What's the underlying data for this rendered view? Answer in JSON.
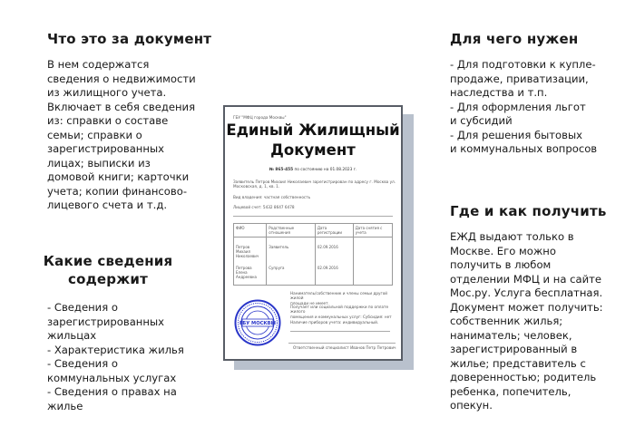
{
  "sections": {
    "what": {
      "heading": "Что это за документ",
      "text": "В нем содержатся\nсведения о недвижимости\nиз жилищного учета.\nВключает в себя сведения\nиз: справки о составе\nсемьи; справки о\nзарегистрированных\nлицах; выписки из\nдомовой книги; карточки\nучета; копии финансово-\nлицевого счета и т.д."
    },
    "contents": {
      "heading": "Какие сведения\nсодержит",
      "text": "- Сведения о\nзарегистрированных\nжильцах\n- Характеристика жилья\n- Сведения о\nкоммунальных услугах\n- Сведения о правах на\nжилье"
    },
    "why": {
      "heading": "Для чего нужен",
      "text": "- Для подготовки к купле-\nпродаже, приватизации,\nнаследства и т.п.\n- Для оформления льгот\nи субсидий\n- Для решения бытовых\nи коммунальных вопросов"
    },
    "where": {
      "heading": "Где и как получить",
      "text": "ЕЖД выдают только в\nМоскве. Его можно\nполучить в любом\nотделении МФЦ и на сайте\nМос.ру. Услуга бесплатная.\nДокумент может получить:\nсобственник жилья;\nнаниматель; человек,\nзарегистрированный в\nжилье; представитель с\nдоверенностью; родитель\nребенка, попечитель,\nопекун."
    }
  },
  "document": {
    "issuer": "ГБУ \"МФЦ города Москвы\"",
    "title": "Единый Жилищный\nДокумент",
    "number_label": "№ 865-455",
    "number_date": "по состоянию на 01.08.2023 г.",
    "applicant": "Заявитель Петров Михаил Николаевич зарегистрирован по адресу г. Москва ул.\nМосковская, д. 1, кв. 1.",
    "ownership": "Вид владения: частная собственность",
    "account": "Лицевой счет: 5432 8647 6478",
    "table": {
      "headers": [
        "ФИО",
        "Родственные отношения",
        "Дата регистрации",
        "Дата снятия с учета"
      ],
      "rows": [
        [
          "Петров Михаил\nНиколаевич",
          "Заявитель",
          "02.09.2016",
          ""
        ],
        [
          "Петрова Елена\nАндреевна",
          "Супруга",
          "02.09.2016",
          ""
        ]
      ]
    },
    "notes": [
      "Наниматель/собственник и члены семьи другой жилой\nплощади не имеет.",
      "Получает или социальной поддержки по оплате жилого\nпомещения и коммунальных услуг: Субсидия: нет",
      "Наличие приборов учета: индивидуальный."
    ],
    "signature": "Ответственный специалист Иванов Петр Петрович",
    "seal_text": "ГБУ МОСКВЫ"
  },
  "colors": {
    "text": "#1a1a1a",
    "card_border": "#585d66",
    "card_shadow": "#b9c1cd",
    "seal_blue": "#2a36c9"
  }
}
